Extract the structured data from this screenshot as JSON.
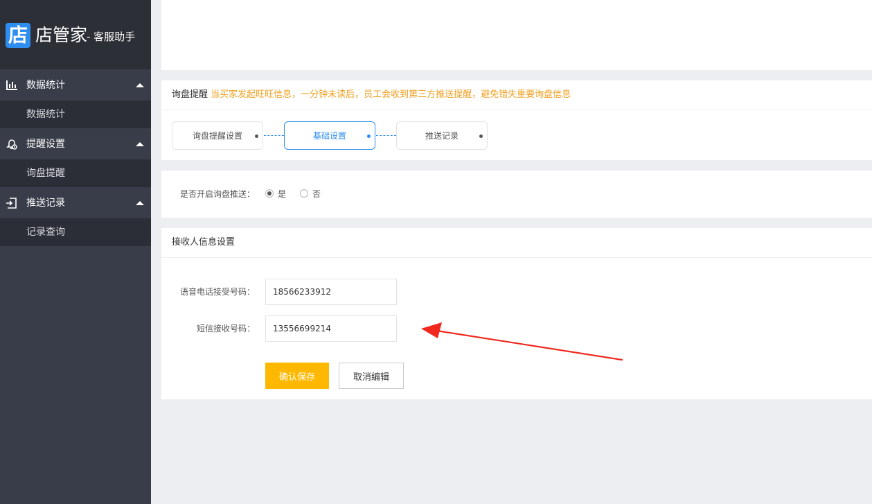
{
  "brand": {
    "logo_char": "店",
    "name": "店管家",
    "subtitle": "- 客服助手",
    "accent_color": "#2e8ef0"
  },
  "sidebar": {
    "groups": [
      {
        "label": "数据统计",
        "icon": "bar-chart-icon",
        "expanded": true,
        "items": [
          {
            "label": "数据统计"
          }
        ]
      },
      {
        "label": "提醒设置",
        "icon": "alarm-gear-icon",
        "expanded": true,
        "items": [
          {
            "label": "询盘提醒"
          }
        ]
      },
      {
        "label": "推送记录",
        "icon": "push-record-icon",
        "expanded": true,
        "items": [
          {
            "label": "记录查询"
          }
        ]
      }
    ]
  },
  "notice": {
    "title": "询盘提醒",
    "description": "当买家发起旺旺信息，一分钟未读后，员工会收到第三方推送提醒，避免错失重要询盘信息",
    "description_color": "#f0a020"
  },
  "steps": [
    {
      "label": "询盘提醒设置",
      "active": false
    },
    {
      "label": "基础设置",
      "active": true
    },
    {
      "label": "推送记录",
      "active": false
    }
  ],
  "push_toggle": {
    "label": "是否开启询盘推送：",
    "options": [
      {
        "label": "是",
        "checked": true
      },
      {
        "label": "否",
        "checked": false
      }
    ]
  },
  "receiver": {
    "title": "接收人信息设置",
    "voice_label": "语音电话接受号码：",
    "voice_value": "18566233912",
    "sms_label": "短信接收号码：",
    "sms_value": "13556699214",
    "save_label": "确认保存",
    "cancel_label": "取消编辑",
    "save_color": "#ffb800"
  }
}
